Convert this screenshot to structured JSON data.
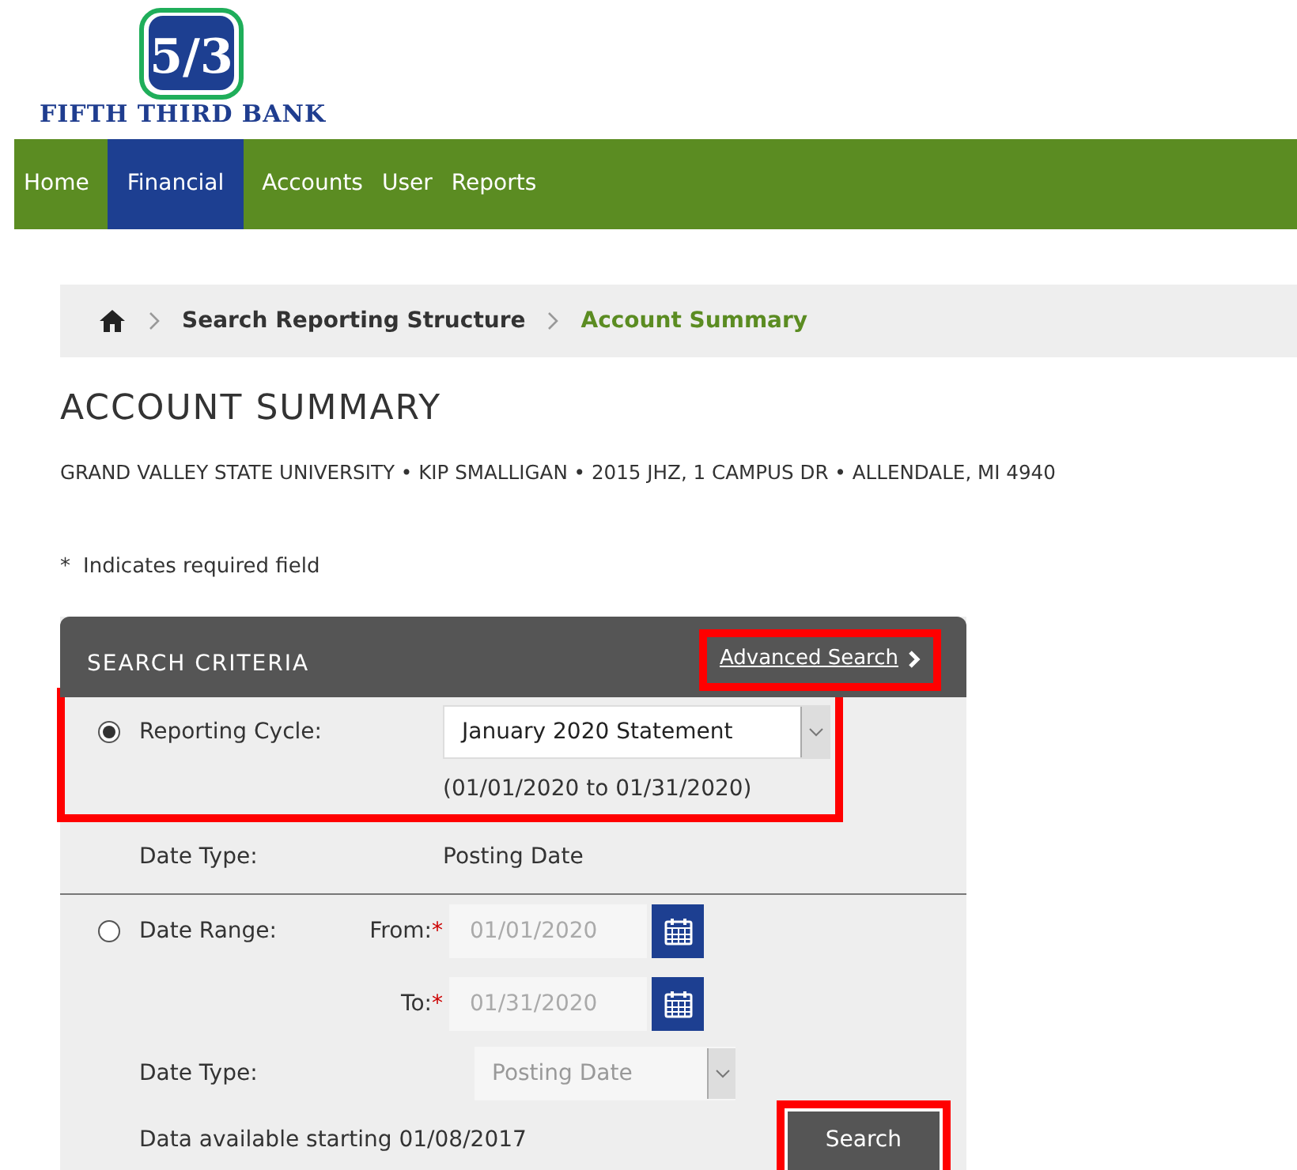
{
  "logo": {
    "mark": "5/3",
    "name": "FIFTH THIRD BANK"
  },
  "nav": [
    {
      "label": "Home",
      "selected": false
    },
    {
      "label": "Financial",
      "selected": true
    },
    {
      "label": "Accounts",
      "selected": false
    },
    {
      "label": "User",
      "selected": false
    },
    {
      "label": "Reports",
      "selected": false
    }
  ],
  "breadcrumb": [
    {
      "kind": "home"
    },
    {
      "kind": "link",
      "label": "Search Reporting Structure"
    },
    {
      "kind": "current",
      "label": "Account Summary"
    }
  ],
  "page_title": "ACCOUNT SUMMARY",
  "account_line": "GRAND VALLEY STATE UNIVERSITY • KIP SMALLIGAN • 2015 JHZ, 1 CAMPUS DR • ALLENDALE, MI 4940",
  "required_note": {
    "mark": "*",
    "text": "Indicates required field"
  },
  "search_criteria": {
    "title": "SEARCH CRITERIA",
    "advanced_search": {
      "label": "Advanced Search",
      "highlighted": true
    },
    "reporting_cycle": {
      "selected": true,
      "highlighted": true,
      "label": "Reporting Cycle:",
      "value": "January 2020 Statement",
      "range": "(01/01/2020 to 01/31/2020)",
      "date_type_label": "Date Type:",
      "date_type": "Posting Date"
    },
    "date_range": {
      "selected": false,
      "disabled": true,
      "label": "Date Range:",
      "from_label": "From:",
      "from_required": "*",
      "from": "01/01/2020",
      "to_label": "To:",
      "to_required": "*",
      "to": "01/31/2020",
      "date_type_label": "Date Type:",
      "date_type": "Posting Date",
      "availability": "Data available starting 01/08/2017"
    },
    "search_button": {
      "label": "Search",
      "highlighted": true
    }
  }
}
